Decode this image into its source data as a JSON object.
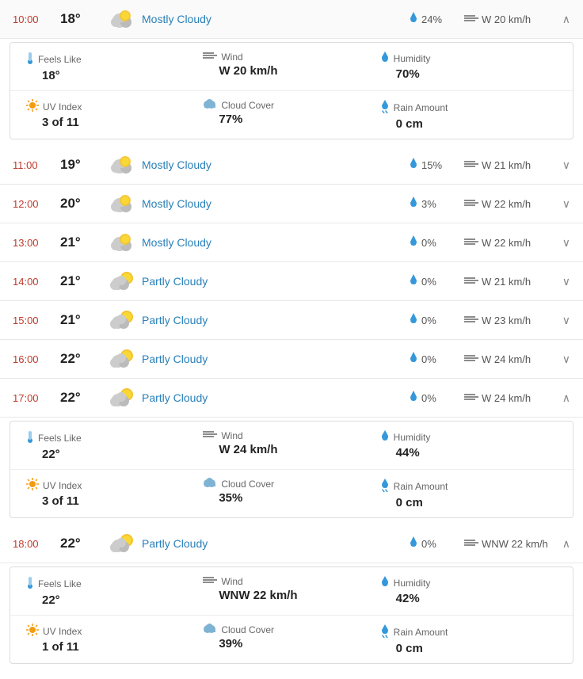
{
  "rows": [
    {
      "time": "10:00",
      "temp": "18°",
      "icon": "mostly-cloudy",
      "description": "Mostly Cloudy",
      "rain": "24%",
      "wind": "W 20 km/h",
      "expanded": true,
      "chevron": "up",
      "details": {
        "feels_like_label": "Feels Like",
        "feels_like": "18°",
        "wind_label": "Wind",
        "wind_val": "W 20 km/h",
        "humidity_label": "Humidity",
        "humidity_val": "70%",
        "uv_label": "UV Index",
        "uv_val": "3 of 11",
        "cloud_label": "Cloud Cover",
        "cloud_val": "77%",
        "rain_label": "Rain Amount",
        "rain_val": "0 cm"
      }
    },
    {
      "time": "11:00",
      "temp": "19°",
      "icon": "mostly-cloudy",
      "description": "Mostly Cloudy",
      "rain": "15%",
      "wind": "W 21 km/h",
      "expanded": false,
      "chevron": "down",
      "details": null
    },
    {
      "time": "12:00",
      "temp": "20°",
      "icon": "mostly-cloudy",
      "description": "Mostly Cloudy",
      "rain": "3%",
      "wind": "W 22 km/h",
      "expanded": false,
      "chevron": "down",
      "details": null
    },
    {
      "time": "13:00",
      "temp": "21°",
      "icon": "mostly-cloudy",
      "description": "Mostly Cloudy",
      "rain": "0%",
      "wind": "W 22 km/h",
      "expanded": false,
      "chevron": "down",
      "details": null
    },
    {
      "time": "14:00",
      "temp": "21°",
      "icon": "partly-cloudy",
      "description": "Partly Cloudy",
      "rain": "0%",
      "wind": "W 21 km/h",
      "expanded": false,
      "chevron": "down",
      "details": null
    },
    {
      "time": "15:00",
      "temp": "21°",
      "icon": "partly-cloudy",
      "description": "Partly Cloudy",
      "rain": "0%",
      "wind": "W 23 km/h",
      "expanded": false,
      "chevron": "down",
      "details": null
    },
    {
      "time": "16:00",
      "temp": "22°",
      "icon": "partly-cloudy",
      "description": "Partly Cloudy",
      "rain": "0%",
      "wind": "W 24 km/h",
      "expanded": false,
      "chevron": "down",
      "details": null
    },
    {
      "time": "17:00",
      "temp": "22°",
      "icon": "partly-cloudy",
      "description": "Partly Cloudy",
      "rain": "0%",
      "wind": "W 24 km/h",
      "expanded": true,
      "chevron": "up",
      "details": {
        "feels_like_label": "Feels Like",
        "feels_like": "22°",
        "wind_label": "Wind",
        "wind_val": "W 24 km/h",
        "humidity_label": "Humidity",
        "humidity_val": "44%",
        "uv_label": "UV Index",
        "uv_val": "3 of 11",
        "cloud_label": "Cloud Cover",
        "cloud_val": "35%",
        "rain_label": "Rain Amount",
        "rain_val": "0 cm"
      }
    },
    {
      "time": "18:00",
      "temp": "22°",
      "icon": "partly-cloudy",
      "description": "Partly Cloudy",
      "rain": "0%",
      "wind": "WNW 22 km/h",
      "expanded": true,
      "chevron": "up",
      "details": {
        "feels_like_label": "Feels Like",
        "feels_like": "22°",
        "wind_label": "Wind",
        "wind_val": "WNW 22 km/h",
        "humidity_label": "Humidity",
        "humidity_val": "42%",
        "uv_label": "UV Index",
        "uv_val": "1 of 11",
        "cloud_label": "Cloud Cover",
        "cloud_val": "39%",
        "rain_label": "Rain Amount",
        "rain_val": "0 cm"
      }
    }
  ]
}
